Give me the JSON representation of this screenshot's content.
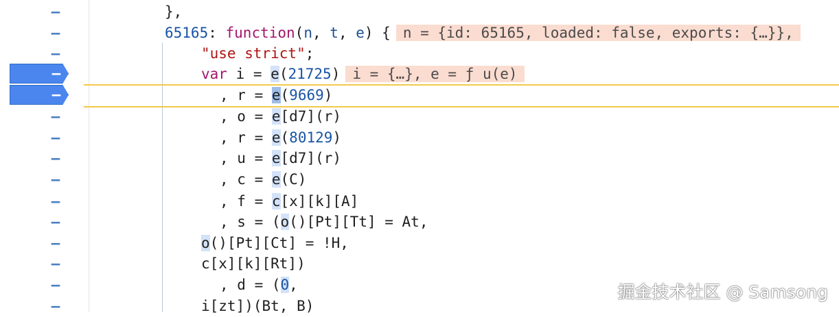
{
  "gutter_marker": "–",
  "lines": [
    {
      "tokens": [
        {
          "t": "},",
          "c": "p"
        }
      ]
    },
    {
      "tokens": [
        {
          "t": "65165",
          "c": "n"
        },
        {
          "t": ": ",
          "c": "p"
        },
        {
          "t": "function",
          "c": "k"
        },
        {
          "t": "(",
          "c": "p"
        },
        {
          "t": "n",
          "c": "v"
        },
        {
          "t": ", ",
          "c": "p"
        },
        {
          "t": "t",
          "c": "v"
        },
        {
          "t": ", ",
          "c": "p"
        },
        {
          "t": "e",
          "c": "v"
        },
        {
          "t": ") {",
          "c": "p"
        }
      ],
      "hint": "n = {id: 65165, loaded: false, exports: {…}},"
    },
    {
      "tokens": [
        {
          "t": "\"use strict\"",
          "c": "s"
        },
        {
          "t": ";",
          "c": "p"
        }
      ]
    },
    {
      "breakpoint": true,
      "tokens": [
        {
          "t": "var",
          "c": "k"
        },
        {
          "t": " i = ",
          "c": "p"
        },
        {
          "t": "e",
          "c": "p",
          "hl": true
        },
        {
          "t": "(",
          "c": "p"
        },
        {
          "t": "21725",
          "c": "n"
        },
        {
          "t": ")",
          "c": "p"
        }
      ],
      "hint": "i = {…}, e = ƒ u(e)"
    },
    {
      "breakpoint": true,
      "paused": true,
      "tokens": [
        {
          "t": ", r = ",
          "c": "p"
        },
        {
          "t": "e",
          "c": "p",
          "cur": true
        },
        {
          "t": "(",
          "c": "p"
        },
        {
          "t": "9669",
          "c": "n"
        },
        {
          "t": ")",
          "c": "p"
        }
      ]
    },
    {
      "tokens": [
        {
          "t": ", o = ",
          "c": "p"
        },
        {
          "t": "e",
          "c": "p",
          "hl": true
        },
        {
          "t": "[d7](r)",
          "c": "p"
        }
      ]
    },
    {
      "tokens": [
        {
          "t": ", r = ",
          "c": "p"
        },
        {
          "t": "e",
          "c": "p",
          "hl": true
        },
        {
          "t": "(",
          "c": "p"
        },
        {
          "t": "80129",
          "c": "n"
        },
        {
          "t": ")",
          "c": "p"
        }
      ]
    },
    {
      "tokens": [
        {
          "t": ", u = ",
          "c": "p"
        },
        {
          "t": "e",
          "c": "p",
          "hl": true
        },
        {
          "t": "[d7](r)",
          "c": "p"
        }
      ]
    },
    {
      "tokens": [
        {
          "t": ", c = ",
          "c": "p"
        },
        {
          "t": "e",
          "c": "p",
          "hl": true
        },
        {
          "t": "(C)",
          "c": "p"
        }
      ]
    },
    {
      "tokens": [
        {
          "t": ", f = ",
          "c": "p"
        },
        {
          "t": "c",
          "c": "p",
          "hl": true
        },
        {
          "t": "[x][k][A]",
          "c": "p"
        }
      ]
    },
    {
      "tokens": [
        {
          "t": ", s = (",
          "c": "p"
        },
        {
          "t": "o",
          "c": "p",
          "hl": true
        },
        {
          "t": "()[Pt][Tt] = At,",
          "c": "p"
        }
      ]
    },
    {
      "tokens": [
        {
          "t": "o",
          "c": "p",
          "hl": true
        },
        {
          "t": "()[Pt][Ct] = !H,",
          "c": "p"
        }
      ]
    },
    {
      "tokens": [
        {
          "t": "c[x][k][Rt])",
          "c": "p"
        }
      ]
    },
    {
      "tokens": [
        {
          "t": ", d = (",
          "c": "p"
        },
        {
          "t": "0",
          "c": "n",
          "hl": true
        },
        {
          "t": ",",
          "c": "p"
        }
      ]
    },
    {
      "tokens": [
        {
          "t": "i[zt])(Bt, B)",
          "c": "p"
        }
      ]
    }
  ],
  "watermark": "掘金技术社区 @ Samsong"
}
